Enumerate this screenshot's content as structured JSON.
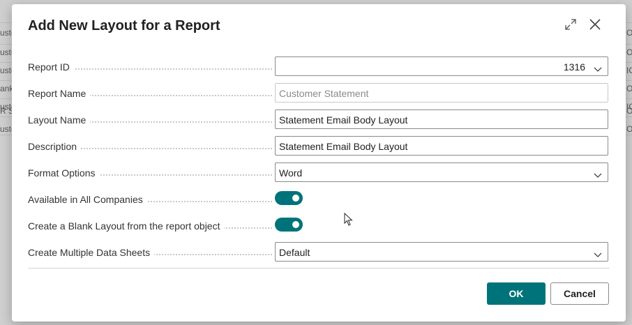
{
  "background": {
    "row_cells": [
      "usto",
      "usto",
      "usto",
      "ank",
      "usto",
      "R S",
      "usto"
    ],
    "right_cells": [
      "OLI",
      "OLI",
      "IO",
      "OLI",
      "IO",
      "OLI",
      "OLI"
    ]
  },
  "dialog": {
    "title": "Add New Layout for a Report",
    "expand_icon": "expand-icon",
    "close_icon": "close-icon"
  },
  "fields": {
    "report_id": {
      "label": "Report ID",
      "value": "1316"
    },
    "report_name": {
      "label": "Report Name",
      "value": "Customer Statement"
    },
    "layout_name": {
      "label": "Layout Name",
      "value": "Statement Email Body Layout"
    },
    "description": {
      "label": "Description",
      "value": "Statement Email Body Layout"
    },
    "format_options": {
      "label": "Format Options",
      "value": "Word"
    },
    "available_all_companies": {
      "label": "Available in All Companies",
      "checked": true
    },
    "create_blank_layout": {
      "label": "Create a Blank Layout from the report object",
      "checked": true
    },
    "multiple_data_sheets": {
      "label": "Create Multiple Data Sheets",
      "value": "Default"
    }
  },
  "buttons": {
    "ok": "OK",
    "cancel": "Cancel"
  },
  "colors": {
    "accent": "#00737a",
    "border": "#8a8a8a"
  }
}
